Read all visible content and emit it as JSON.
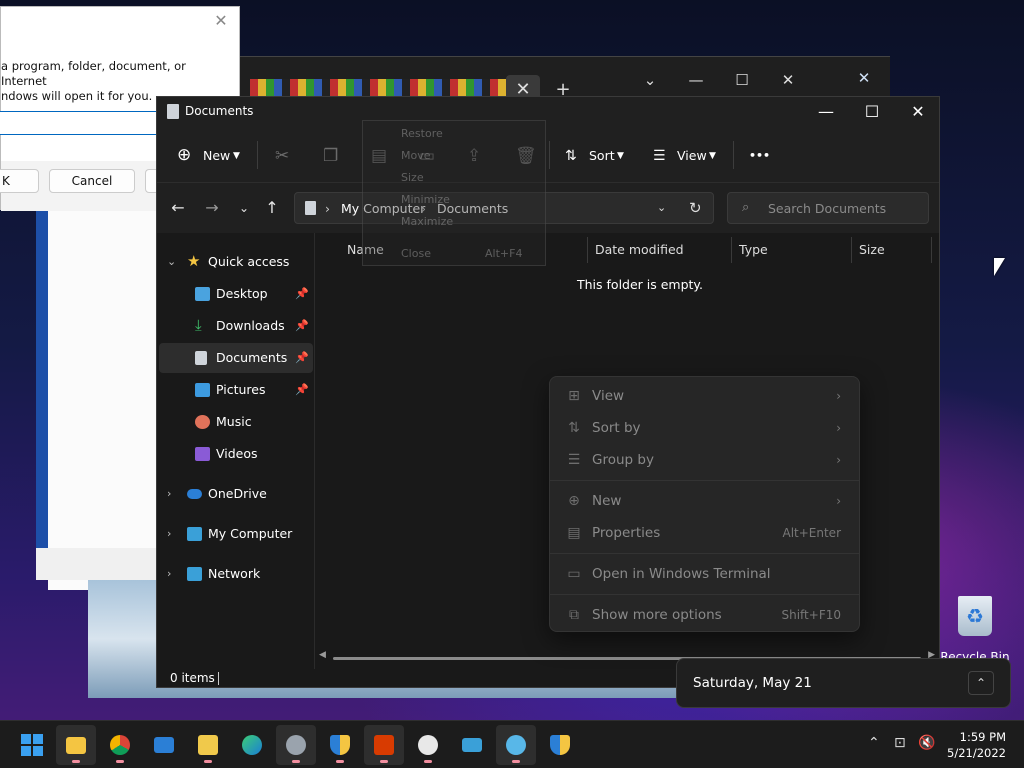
{
  "run_dialog": {
    "description_line1": "a program, folder, document, or Internet",
    "description_line2": "ndows will open it for you.",
    "ok_label": "K",
    "cancel_label": "Cancel"
  },
  "explorer": {
    "title": "Documents",
    "window_controls": {
      "minimize": "—",
      "maximize": "☐",
      "close": "✕"
    },
    "toolbar": {
      "new_label": "New",
      "sort_label": "Sort",
      "view_label": "View",
      "more_label": "•••"
    },
    "address": {
      "segments": [
        "My Computer",
        "Documents"
      ],
      "search_placeholder": "Search Documents"
    },
    "nav": {
      "quick_access": "Quick access",
      "desktop": "Desktop",
      "downloads": "Downloads",
      "documents": "Documents",
      "pictures": "Pictures",
      "music": "Music",
      "videos": "Videos",
      "onedrive": "OneDrive",
      "my_computer": "My Computer",
      "network": "Network"
    },
    "columns": {
      "name": "Name",
      "date_modified": "Date modified",
      "type": "Type",
      "size": "Size"
    },
    "empty_message": "This folder is empty.",
    "status": "0 items"
  },
  "system_menu_ghost": {
    "restore": "Restore",
    "move": "Move",
    "size": "Size",
    "minimize": "Minimize",
    "maximize": "Maximize",
    "close": "Close",
    "close_shortcut": "Alt+F4"
  },
  "context_menu": {
    "view": "View",
    "sort_by": "Sort by",
    "group_by": "Group by",
    "new": "New",
    "properties": "Properties",
    "properties_shortcut": "Alt+Enter",
    "open_terminal": "Open in Windows Terminal",
    "show_more": "Show more options",
    "show_more_shortcut": "Shift+F10"
  },
  "desktop": {
    "recycle_bin": "Recycle Bin"
  },
  "flyout": {
    "date": "Saturday, May 21"
  },
  "taskbar": {
    "time": "1:59 PM",
    "date": "5/21/2022"
  },
  "colors": {
    "accent": "#0067c0",
    "folder_yellow": "#f4c542",
    "taskbar_dot": "#f28fa0"
  }
}
